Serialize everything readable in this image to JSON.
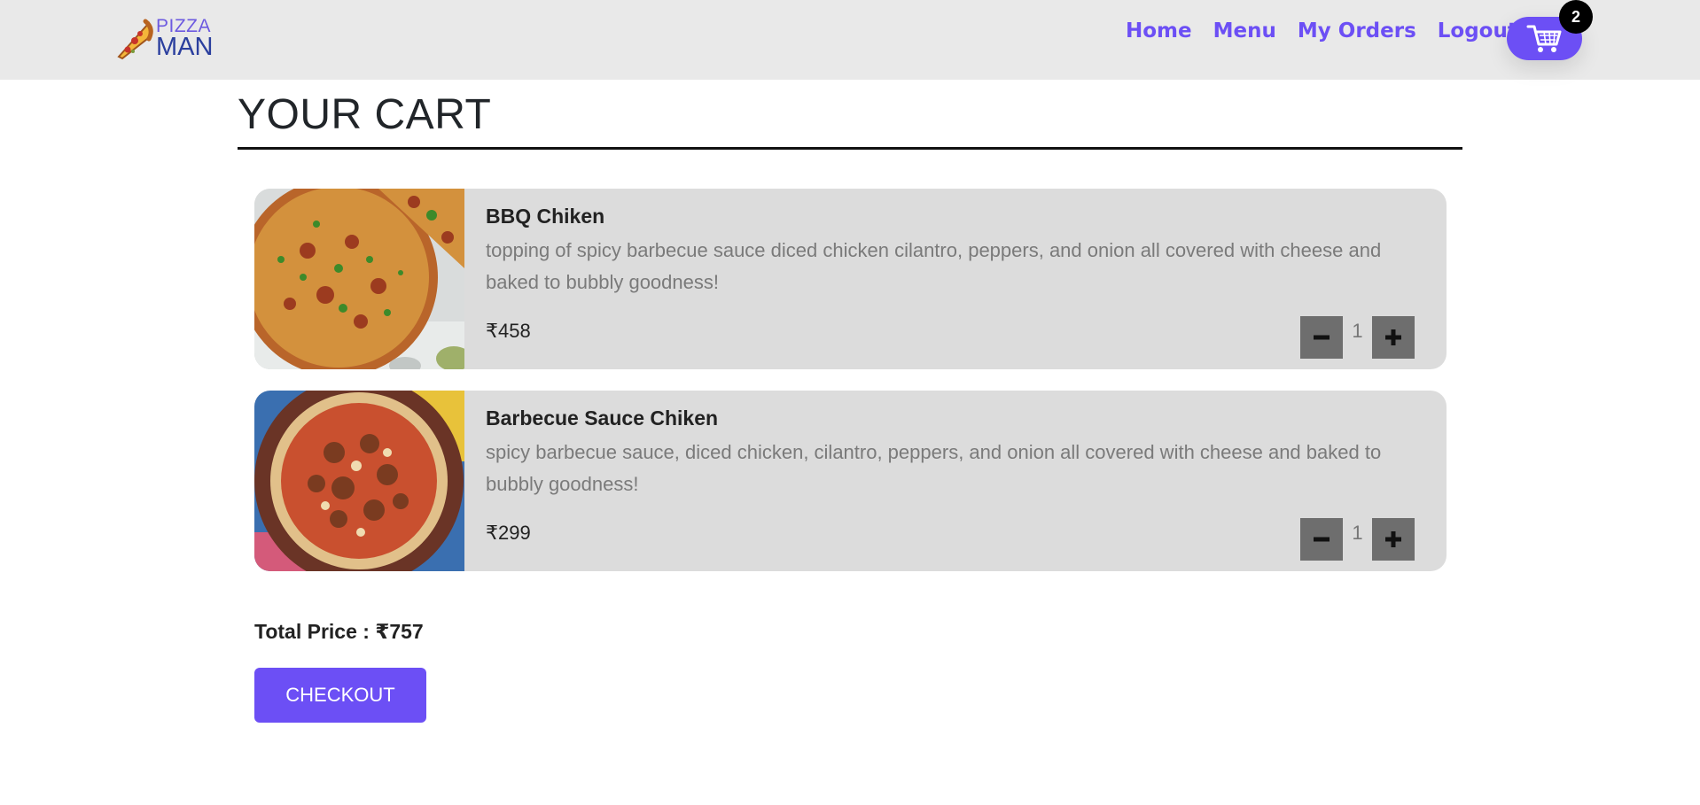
{
  "brand": {
    "line1": "PIZZA",
    "line2": "MAN",
    "icon": "pizza-slice-icon"
  },
  "nav": {
    "links": [
      "Home",
      "Menu",
      "My Orders",
      "Logout"
    ],
    "cart_icon": "shopping-cart-icon",
    "cart_count": "2"
  },
  "page": {
    "title": "YOUR CART"
  },
  "cart": {
    "items": [
      {
        "name": "BBQ Chiken",
        "description": "topping of spicy barbecue sauce diced chicken cilantro, peppers, and onion all covered with cheese and baked to bubbly goodness!",
        "price": "₹458",
        "quantity": "1",
        "minus_icon": "minus-icon",
        "plus_icon": "plus-icon"
      },
      {
        "name": "Barbecue Sauce Chiken",
        "description": "spicy barbecue sauce, diced chicken, cilantro, peppers, and onion all covered with cheese and baked to bubbly goodness!",
        "price": "₹299",
        "quantity": "1",
        "minus_icon": "minus-icon",
        "plus_icon": "plus-icon"
      }
    ],
    "total_label": "Total Price : ₹757",
    "checkout_label": "CHECKOUT"
  },
  "colors": {
    "accent": "#6c4ff5",
    "navbar_bg": "#e9e9e9",
    "card_bg": "#dcdcdc",
    "qty_button": "#6e6e6e"
  }
}
